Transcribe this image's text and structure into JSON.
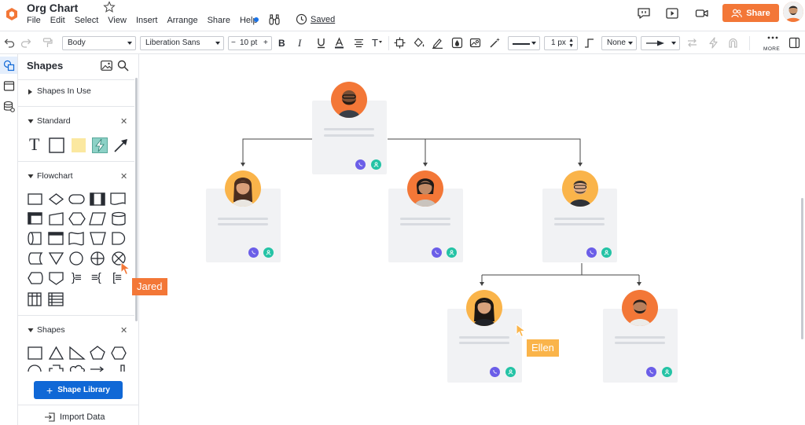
{
  "app": {
    "doc_title": "Org Chart",
    "saved_label": "Saved",
    "share_label": "Share",
    "menu": [
      "File",
      "Edit",
      "Select",
      "View",
      "Insert",
      "Arrange",
      "Share",
      "Help"
    ]
  },
  "colors": {
    "accent": "#f37737",
    "primary_button": "#1068d6",
    "help_dot": "#1a73e8",
    "badge_phone": "#6b5ee8",
    "badge_person": "#24c3a5",
    "cursor_jared": "#f37737",
    "cursor_ellen": "#fab44a"
  },
  "toolbar": {
    "style_value": "Body",
    "font_value": "Liberation Sans",
    "font_size_value": "10 pt",
    "bold_label": "B",
    "italic_label": "I",
    "text_options_label": "T",
    "line_width_value": "1 px",
    "arrow_start_value": "None",
    "more_label": "MORE"
  },
  "panel": {
    "title": "Shapes",
    "sections": [
      {
        "label": "Shapes In Use",
        "expanded": false,
        "closable": false
      },
      {
        "label": "Standard",
        "expanded": true,
        "closable": true
      },
      {
        "label": "Flowchart",
        "expanded": true,
        "closable": true
      },
      {
        "label": "Shapes",
        "expanded": true,
        "closable": true
      }
    ],
    "standard_text_glyph": "T",
    "flowchart_bracket_glyphs": [
      "}≡",
      "≡{",
      "[≡"
    ],
    "shape_library_label": "Shape Library",
    "import_data_label": "Import Data"
  },
  "org_chart": {
    "nodes": [
      {
        "id": "ceo",
        "level": 0
      },
      {
        "id": "report-left",
        "level": 1
      },
      {
        "id": "report-middle",
        "level": 1
      },
      {
        "id": "report-right",
        "level": 1
      },
      {
        "id": "sub-left",
        "level": 2
      },
      {
        "id": "sub-right",
        "level": 2
      }
    ]
  },
  "collaborators": [
    {
      "name": "Jared",
      "icon": "cursor-arrow-icon"
    },
    {
      "name": "Ellen",
      "icon": "cursor-arrow-icon"
    }
  ]
}
